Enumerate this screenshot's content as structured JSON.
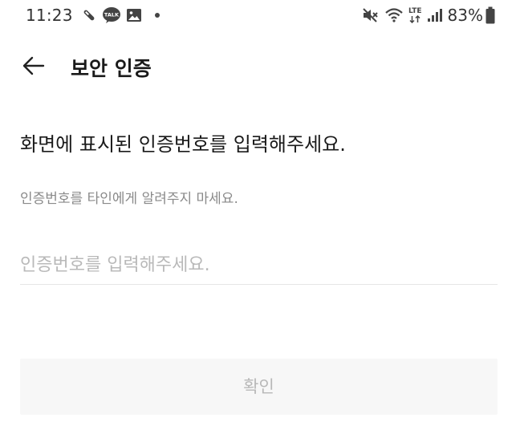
{
  "status_bar": {
    "time": "11:23",
    "battery_percent": "83%",
    "network_label": "LTE",
    "icons": [
      "wrench-icon",
      "kakaotalk-icon",
      "gallery-icon",
      "notification-dot-icon",
      "mute-icon",
      "wifi-icon",
      "lte-icon",
      "signal-icon",
      "battery-icon"
    ],
    "kakaotalk_badge": "TALK"
  },
  "header": {
    "back_icon": "back-arrow-icon",
    "title": "보안 인증"
  },
  "main": {
    "instruction": "화면에 표시된 인증번호를 입력해주세요.",
    "warning": "인증번호를 타인에게 알려주지 마세요.",
    "code_input": {
      "value": "",
      "placeholder": "인증번호를 입력해주세요."
    },
    "confirm_button": {
      "label": "확인",
      "enabled": false
    }
  },
  "colors": {
    "background": "#ffffff",
    "title_text": "#1a1a1a",
    "secondary_text": "#8a8a8a",
    "placeholder_text": "#b9b9b9",
    "button_background": "#f7f7f7",
    "button_text_disabled": "#b8b8b8",
    "divider": "#e6e6e6"
  }
}
